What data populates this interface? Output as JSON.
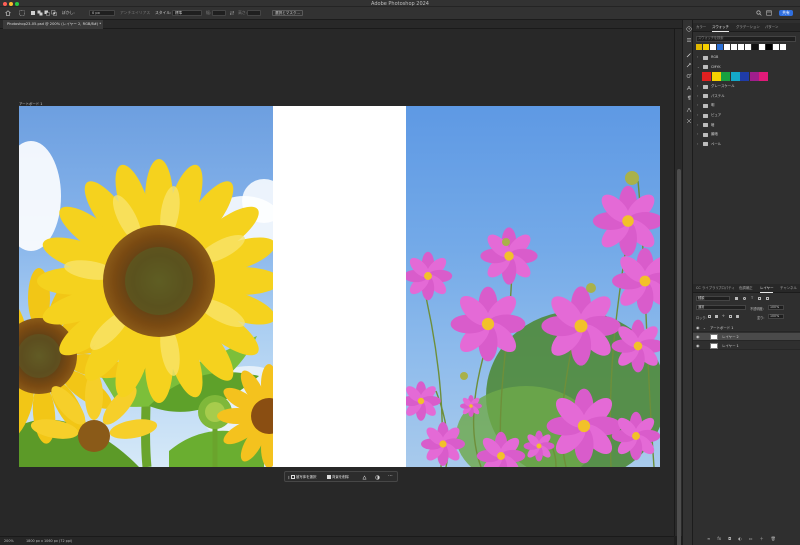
{
  "window": {
    "title": "Adobe Photoshop 2024"
  },
  "options_bar": {
    "feather_label": "ぼかし:",
    "feather_value": "0 px",
    "antialias_label": "アンチエイリアス",
    "style_label": "スタイル:",
    "style_value": "標準",
    "width_label": "幅:",
    "height_label": "高さ:",
    "select_mask_label": "選択とマスク...",
    "share_label": "共有"
  },
  "document": {
    "tab_label": "Photoshop23-05.psd @ 200% (レイヤー 2, RGB/8#) *",
    "artboard_label": "アートボード 1",
    "zoom": "200%",
    "doc_info": "1800 px x 1060 px (72 ppi)"
  },
  "taskbar": {
    "select_subject": "被写体を選択",
    "remove_background": "背景を削除"
  },
  "swatches_panel": {
    "tabs": [
      "カラー",
      "スウォッチ",
      "グラデーション",
      "パターン"
    ],
    "search_placeholder": "スウォッチを検索",
    "recent_colors": [
      "#e0b800",
      "#f5d000",
      "#ffffff",
      "#2a6fd6",
      "#ffffff",
      "#ffffff",
      "#ffffff",
      "#ffffff",
      "#111111",
      "#ffffff",
      "#000000",
      "#ffffff",
      "#ffffff"
    ],
    "groups": [
      {
        "label": "RGB",
        "expanded": false
      },
      {
        "label": "CMYK",
        "expanded": true
      },
      {
        "label": "グレースケール",
        "expanded": false
      },
      {
        "label": "パステル",
        "expanded": false
      },
      {
        "label": "明",
        "expanded": false
      },
      {
        "label": "ピュア",
        "expanded": false
      },
      {
        "label": "暗",
        "expanded": false
      },
      {
        "label": "最暗",
        "expanded": false
      },
      {
        "label": "ペール",
        "expanded": false
      }
    ],
    "cmyk_colors": [
      "#e02020",
      "#f5d000",
      "#18a040",
      "#14a8c8",
      "#1f3ca8",
      "#a01e8c",
      "#e01a78"
    ]
  },
  "layers_panel": {
    "tabs": [
      "CC ライブラリ",
      "プロパティ",
      "色調補正",
      "レイヤー",
      "チャンネル"
    ],
    "filter_label": "種類",
    "blend_mode": "通常",
    "opacity_label": "不透明度:",
    "opacity_value": "100%",
    "lock_label": "ロック:",
    "fill_label": "塗り:",
    "fill_value": "100%",
    "layers": [
      {
        "name": "アートボード 1",
        "kind": "artboard"
      },
      {
        "name": "レイヤー 2",
        "kind": "pixel",
        "selected": true
      },
      {
        "name": "レイヤー 1",
        "kind": "pixel",
        "selected": false
      }
    ]
  }
}
